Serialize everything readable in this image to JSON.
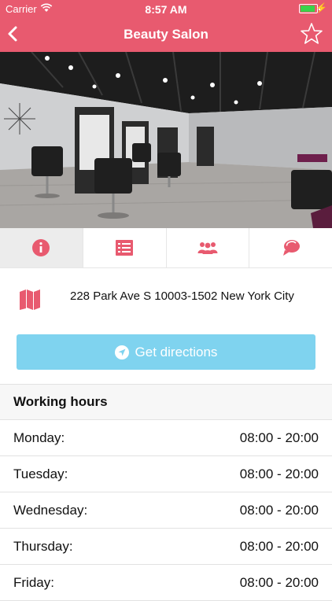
{
  "status_bar": {
    "carrier": "Carrier",
    "time": "8:57 AM"
  },
  "nav": {
    "title": "Beauty Salon",
    "back_icon": "chevron-left-icon",
    "favorite_icon": "star-outline-icon"
  },
  "colors": {
    "brand": "#e85a6f",
    "directions_button": "#7fd3ef"
  },
  "tabs": [
    {
      "icon": "info-icon",
      "active": true
    },
    {
      "icon": "list-icon",
      "active": false
    },
    {
      "icon": "people-icon",
      "active": false
    },
    {
      "icon": "chat-bubbles-icon",
      "active": false
    }
  ],
  "address": {
    "text": "228 Park Ave S 10003-1502 New York City",
    "icon": "map-icon"
  },
  "directions": {
    "label": "Get directions",
    "icon": "navigation-arrow-icon"
  },
  "working_hours": {
    "title": "Working hours",
    "rows": [
      {
        "day": "Monday:",
        "time": "08:00 - 20:00"
      },
      {
        "day": "Tuesday:",
        "time": "08:00 - 20:00"
      },
      {
        "day": "Wednesday:",
        "time": "08:00 - 20:00"
      },
      {
        "day": "Thursday:",
        "time": "08:00 - 20:00"
      },
      {
        "day": "Friday:",
        "time": "08:00 - 20:00"
      }
    ]
  }
}
